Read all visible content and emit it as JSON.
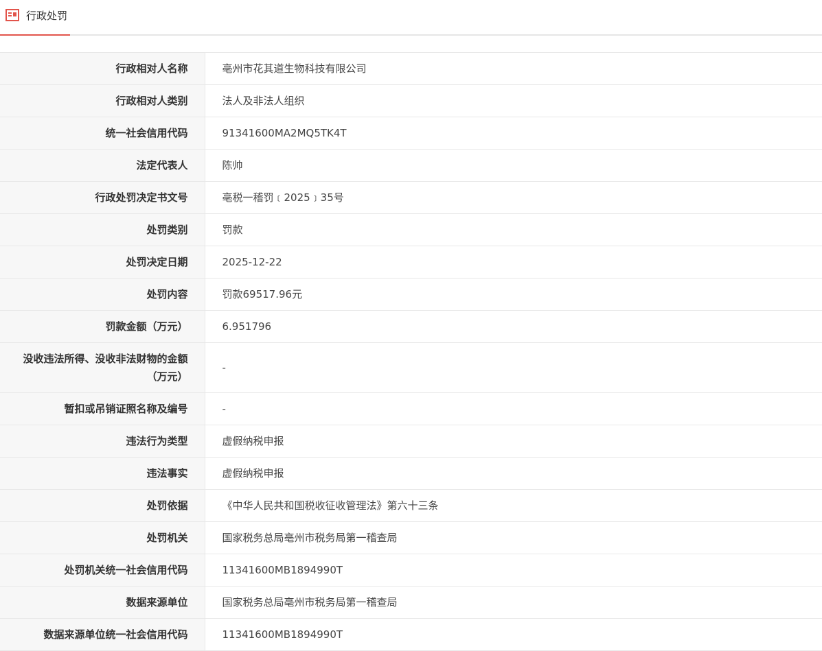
{
  "tab": {
    "label": "行政处罚",
    "icon": "document-list-icon",
    "accent_color": "#e2544b"
  },
  "rows": [
    {
      "label": "行政相对人名称",
      "value": "亳州市花其道生物科技有限公司"
    },
    {
      "label": "行政相对人类别",
      "value": "法人及非法人组织"
    },
    {
      "label": "统一社会信用代码",
      "value": "91341600MA2MQ5TK4T"
    },
    {
      "label": "法定代表人",
      "value": "陈帅"
    },
    {
      "label": "行政处罚决定书文号",
      "value": "亳税一稽罚﹝2025﹞35号"
    },
    {
      "label": "处罚类别",
      "value": "罚款"
    },
    {
      "label": "处罚决定日期",
      "value": "2025-12-22"
    },
    {
      "label": "处罚内容",
      "value": "罚款69517.96元"
    },
    {
      "label": "罚款金额（万元）",
      "value": "6.951796"
    },
    {
      "label": "没收违法所得、没收非法财物的金额（万元）",
      "value": "-"
    },
    {
      "label": "暂扣或吊销证照名称及编号",
      "value": "-"
    },
    {
      "label": "违法行为类型",
      "value": "虚假纳税申报"
    },
    {
      "label": "违法事实",
      "value": "虚假纳税申报"
    },
    {
      "label": "处罚依据",
      "value": "《中华人民共和国税收征收管理法》第六十三条"
    },
    {
      "label": "处罚机关",
      "value": "国家税务总局亳州市税务局第一稽查局"
    },
    {
      "label": "处罚机关统一社会信用代码",
      "value": "11341600MB1894990T"
    },
    {
      "label": "数据来源单位",
      "value": "国家税务总局亳州市税务局第一稽查局"
    },
    {
      "label": "数据来源单位统一社会信用代码",
      "value": "11341600MB1894990T"
    }
  ]
}
